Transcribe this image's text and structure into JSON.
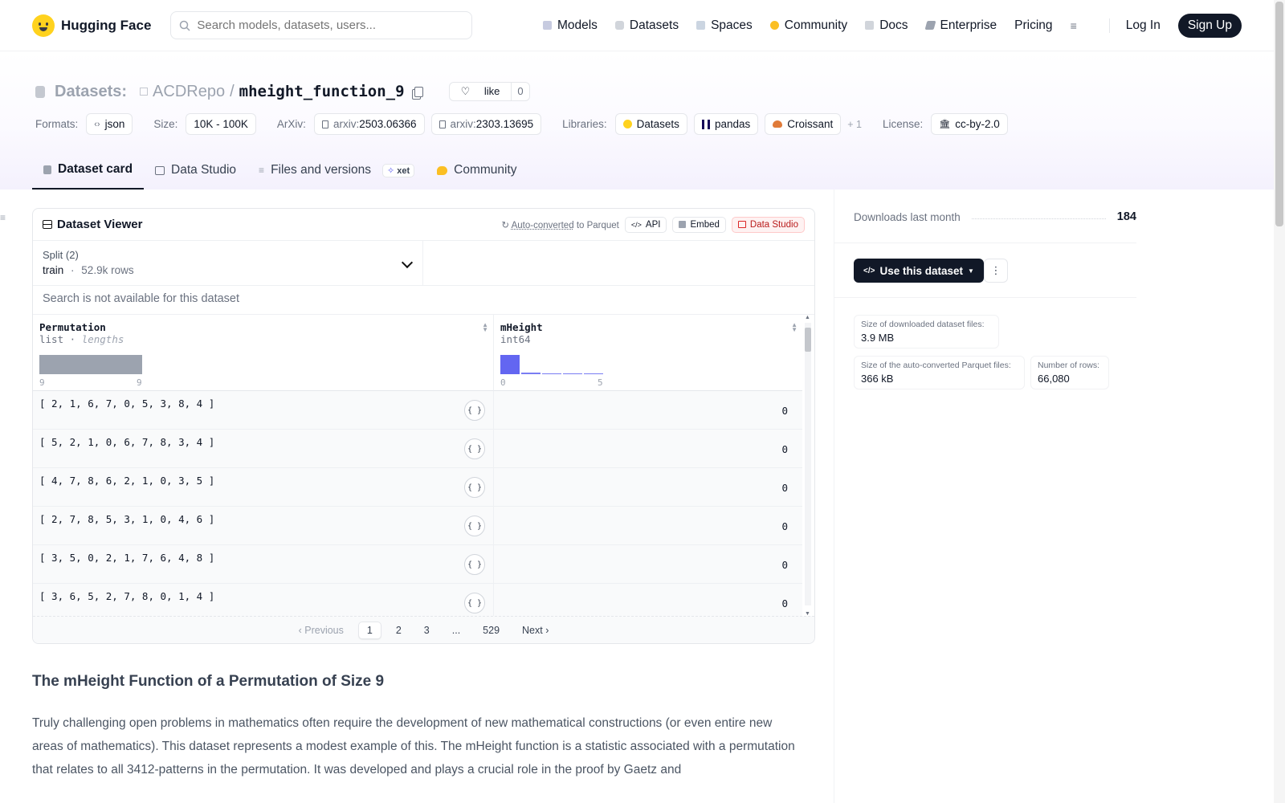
{
  "nav": {
    "brand": "Hugging Face",
    "search_placeholder": "Search models, datasets, users...",
    "links": {
      "models": "Models",
      "datasets": "Datasets",
      "spaces": "Spaces",
      "community": "Community",
      "docs": "Docs",
      "enterprise": "Enterprise",
      "pricing": "Pricing"
    },
    "login": "Log In",
    "signup": "Sign Up"
  },
  "header": {
    "datasets_label": "Datasets:",
    "owner": "ACDRepo",
    "slash": "/",
    "name": "mheight_function_9",
    "like_label": "like",
    "like_count": "0",
    "formats_label": "Formats:",
    "format": "json",
    "size_label": "Size:",
    "size": "10K - 100K",
    "arxiv_label": "ArXiv:",
    "arxiv_prefix": "arxiv:",
    "arxiv1": "2503.06366",
    "arxiv2": "2303.13695",
    "libraries_label": "Libraries:",
    "lib1": "Datasets",
    "lib2": "pandas",
    "lib3": "Croissant",
    "lib_more": "+ 1",
    "license_label": "License:",
    "license": "cc-by-2.0"
  },
  "tabs": {
    "card": "Dataset card",
    "studio": "Data Studio",
    "files": "Files and versions",
    "xet": "xet",
    "community": "Community"
  },
  "viewer": {
    "title": "Dataset Viewer",
    "auto_converted": "Auto-converted",
    "to_parquet": "to Parquet",
    "api": "API",
    "embed": "Embed",
    "studio": "Data Studio",
    "split_label": "Split (2)",
    "split_name": "train",
    "split_dot": "·",
    "split_rows": "52.9k rows",
    "search_na": "Search is not available for this dataset",
    "col1_name": "Permutation",
    "col1_type": "list",
    "col1_sub": "lengths",
    "col1_min": "9",
    "col1_max": "9",
    "col2_name": "mHeight",
    "col2_type": "int64",
    "col2_min": "0",
    "col2_max": "5",
    "rows": [
      {
        "perm": "[ 2, 1, 6, 7, 0, 5, 3, 8, 4 ]",
        "mh": "0"
      },
      {
        "perm": "[ 5, 2, 1, 0, 6, 7, 8, 3, 4 ]",
        "mh": "0"
      },
      {
        "perm": "[ 4, 7, 8, 6, 2, 1, 0, 3, 5 ]",
        "mh": "0"
      },
      {
        "perm": "[ 2, 7, 8, 5, 3, 1, 0, 4, 6 ]",
        "mh": "0"
      },
      {
        "perm": "[ 3, 5, 0, 2, 1, 7, 6, 4, 8 ]",
        "mh": "0"
      },
      {
        "perm": "[ 3, 6, 5, 2, 7, 8, 0, 1, 4 ]",
        "mh": "0"
      }
    ],
    "pager": {
      "prev": "Previous",
      "p1": "1",
      "p2": "2",
      "p3": "3",
      "ellipsis": "...",
      "last": "529",
      "next": "Next"
    }
  },
  "readme": {
    "heading": "The mHeight Function of a Permutation of Size 9",
    "para": "Truly challenging open problems in mathematics often require the development of new mathematical constructions (or even entire new areas of mathematics). This dataset represents a modest example of this. The mHeight function is a statistic associated with a permutation that relates to all 3412-patterns in the permutation. It was developed and plays a crucial role in the proof by Gaetz and"
  },
  "sidebar": {
    "downloads_label": "Downloads last month",
    "downloads": "184",
    "use_dataset": "Use this dataset",
    "stat1_k": "Size of downloaded dataset files:",
    "stat1_v": "3.9 MB",
    "stat2_k": "Size of the auto-converted Parquet files:",
    "stat2_v": "366 kB",
    "stat3_k": "Number of rows:",
    "stat3_v": "66,080"
  },
  "colors": {
    "accent": "#6366f1",
    "dark": "#111827",
    "brand_yellow": "#ffd21e"
  },
  "histograms": {
    "mheight_bins": [
      1.0,
      0.07,
      0.04,
      0.03,
      0.02
    ]
  }
}
